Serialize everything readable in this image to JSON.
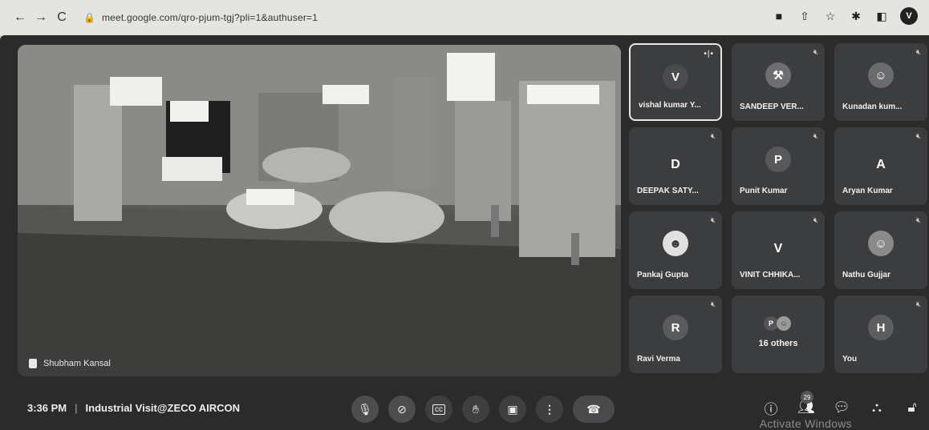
{
  "browser": {
    "url": "meet.google.com/qro-pjum-tgj?pli=1&authuser=1",
    "profile_initial": "V"
  },
  "stage": {
    "presenter_name": "Shubham Kansal"
  },
  "participants": [
    {
      "name": "vishal kumar Y...",
      "initial": "V",
      "avatar_color": "#4a4b4d",
      "speaking": true
    },
    {
      "name": "SANDEEP VER...",
      "initial": "",
      "avatar_color": "#6d6e70",
      "speaking": false
    },
    {
      "name": "Kunadan kum...",
      "initial": "",
      "avatar_color": "#6a6b6d",
      "speaking": false
    },
    {
      "name": "DEEPAK SATY...",
      "initial": "D",
      "avatar_color": "",
      "speaking": false
    },
    {
      "name": "Punit Kumar",
      "initial": "P",
      "avatar_color": "#575859",
      "speaking": false
    },
    {
      "name": "Aryan Kumar",
      "initial": "A",
      "avatar_color": "",
      "speaking": false
    },
    {
      "name": "Pankaj Gupta",
      "initial": "",
      "avatar_color": "#e0e0e0",
      "speaking": false
    },
    {
      "name": "VINIT CHHIKA...",
      "initial": "V",
      "avatar_color": "",
      "speaking": false
    },
    {
      "name": "Nathu Gujjar",
      "initial": "",
      "avatar_color": "#8a8a88",
      "speaking": false
    },
    {
      "name": "Ravi Verma",
      "initial": "R",
      "avatar_color": "#5a5b5d",
      "speaking": false
    },
    {
      "name": "16 others",
      "initial": "P",
      "avatar_color": "#555658",
      "speaking": false
    },
    {
      "name": "You",
      "initial": "H",
      "avatar_color": "#5d5e60",
      "speaking": false
    }
  ],
  "meeting": {
    "time": "3:36 PM",
    "separator": "|",
    "title": "Industrial Visit@ZECO AIRCON"
  },
  "people_count": "29",
  "watermark": "Activate Windows"
}
